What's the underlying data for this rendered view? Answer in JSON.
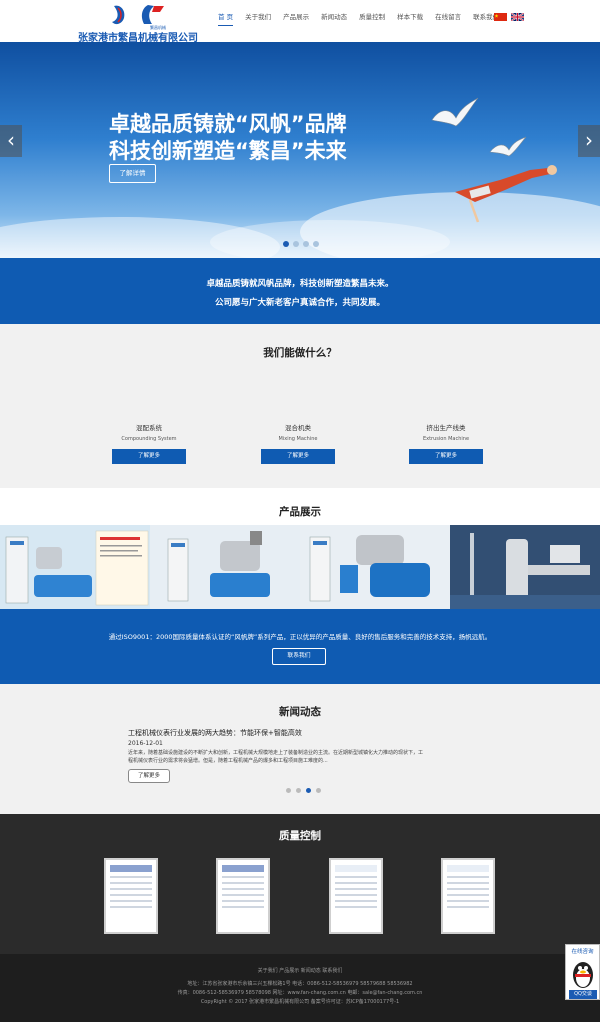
{
  "header": {
    "logo_text": "张家港市繁昌机械有限公司",
    "nav": [
      "首 页",
      "关于我们",
      "产品展示",
      "新闻动态",
      "质量控制",
      "样本下载",
      "在线留言",
      "联系我们"
    ]
  },
  "hero": {
    "line1": "卓越品质铸就“风帆”品牌",
    "line2": "科技创新塑造“繁昌”未来",
    "button": "了解详情",
    "prev": "‹",
    "next": "›"
  },
  "slogan": {
    "line1": "卓越品质铸就风帆品牌，科技创新塑造繁昌未来。",
    "line2": "公司愿与广大新老客户真诚合作，共同发展。"
  },
  "services": {
    "title": "我们能做什么？",
    "items": [
      {
        "cn": "混配系统",
        "en": "Compounding System",
        "button": "了解更多"
      },
      {
        "cn": "混合机类",
        "en": "Mixing Machine",
        "button": "了解更多"
      },
      {
        "cn": "挤出生产线类",
        "en": "Extrusion Machine",
        "button": "了解更多"
      }
    ]
  },
  "products": {
    "title": "产品展示",
    "desc": "通过ISO9001：2000国际质量体系认证的“风帆牌”系列产品，正以优异的产品质量、良好的售后服务和完善的技术支持，扬帆远航。",
    "button": "联系我们"
  },
  "news": {
    "title": "新闻动态",
    "headline": "工程机械仪表行业发展的两大趋势：节能环保+智能高效",
    "date": "2016-12-01",
    "body": "近年来，随着基础设施建设的不断扩大和创新，工程机械大规模地走上了装备制造业的主流。在近期新型城镇化大力推动的现状下，工程机械仪表行业的需求将会猛增。但是，随着工程机械产品的爆多和工程项目施工难度的...",
    "button": "了解更多"
  },
  "quality": {
    "title": "质量控制"
  },
  "footer": {
    "links": "关于我们  产品展示  新闻动态  联系我们",
    "address": "地址：江苏省张家港市乐余镇三兴五棵松路1号 电话：0086-512-58536979 58579688 58536982",
    "contact": "传真：0086-512-58536979 58578098 网址：www.fan-chang.com.cn 电邮：sale@fan-chang.com.cn",
    "copyright": "CopyRight © 2017 张家港市繁昌机械有限公司 备案号许可证：苏ICP备17000177号-1"
  },
  "qq": {
    "label": "在线咨询",
    "button": "QQ交谈"
  },
  "colors": {
    "brand_blue": "#0f5bb2",
    "dark_section": "#2b2b2b",
    "footer": "#1e1e1e"
  }
}
